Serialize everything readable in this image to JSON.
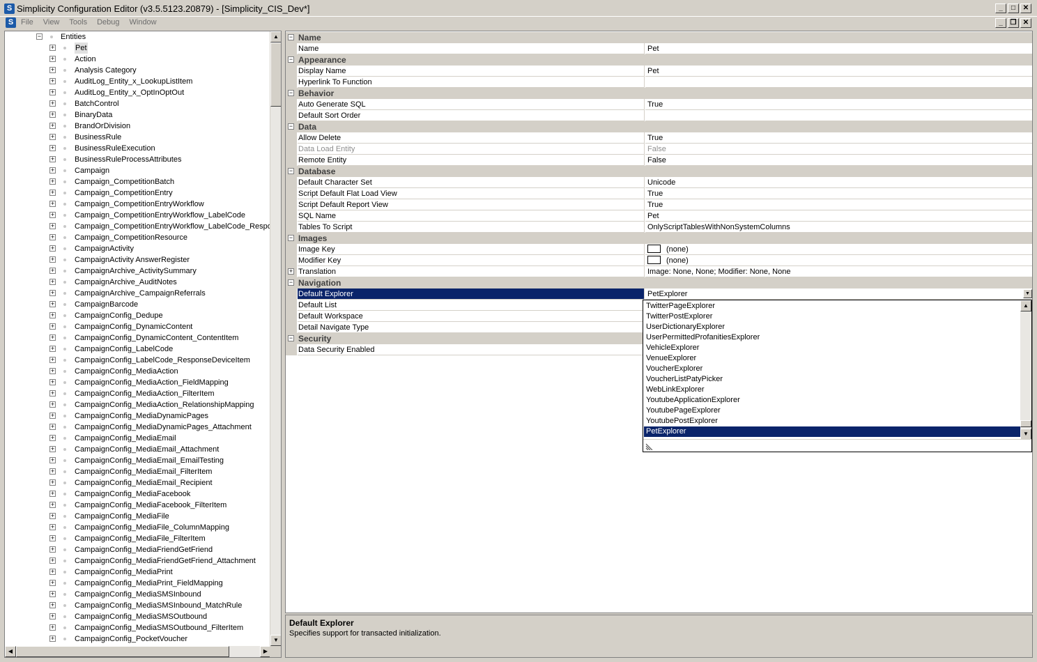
{
  "window": {
    "app_icon": "S",
    "title": "Simplicity Configuration Editor (v3.5.5123.20879) - [Simplicity_CIS_Dev*]",
    "controls": [
      "_",
      "□",
      "✕"
    ]
  },
  "menu": {
    "items": [
      "File",
      "View",
      "Tools",
      "Debug",
      "Window"
    ],
    "mdi_controls": [
      "_",
      "❐",
      "✕"
    ]
  },
  "tree": {
    "root": "Entities",
    "items": [
      "Pet",
      "Action",
      "Analysis Category",
      "AuditLog_Entity_x_LookupListItem",
      "AuditLog_Entity_x_OptInOptOut",
      "BatchControl",
      "BinaryData",
      "BrandOrDivision",
      "BusinessRule",
      "BusinessRuleExecution",
      "BusinessRuleProcessAttributes",
      "Campaign",
      "Campaign_CompetitionBatch",
      "Campaign_CompetitionEntry",
      "Campaign_CompetitionEntryWorkflow",
      "Campaign_CompetitionEntryWorkflow_LabelCode",
      "Campaign_CompetitionEntryWorkflow_LabelCode_Responses",
      "Campaign_CompetitionResource",
      "CampaignActivity",
      "CampaignActivity AnswerRegister",
      "CampaignArchive_ActivitySummary",
      "CampaignArchive_AuditNotes",
      "CampaignArchive_CampaignReferrals",
      "CampaignBarcode",
      "CampaignConfig_Dedupe",
      "CampaignConfig_DynamicContent",
      "CampaignConfig_DynamicContent_ContentItem",
      "CampaignConfig_LabelCode",
      "CampaignConfig_LabelCode_ResponseDeviceItem",
      "CampaignConfig_MediaAction",
      "CampaignConfig_MediaAction_FieldMapping",
      "CampaignConfig_MediaAction_FilterItem",
      "CampaignConfig_MediaAction_RelationshipMapping",
      "CampaignConfig_MediaDynamicPages",
      "CampaignConfig_MediaDynamicPages_Attachment",
      "CampaignConfig_MediaEmail",
      "CampaignConfig_MediaEmail_Attachment",
      "CampaignConfig_MediaEmail_EmailTesting",
      "CampaignConfig_MediaEmail_FilterItem",
      "CampaignConfig_MediaEmail_Recipient",
      "CampaignConfig_MediaFacebook",
      "CampaignConfig_MediaFacebook_FilterItem",
      "CampaignConfig_MediaFile",
      "CampaignConfig_MediaFile_ColumnMapping",
      "CampaignConfig_MediaFile_FilterItem",
      "CampaignConfig_MediaFriendGetFriend",
      "CampaignConfig_MediaFriendGetFriend_Attachment",
      "CampaignConfig_MediaPrint",
      "CampaignConfig_MediaPrint_FieldMapping",
      "CampaignConfig_MediaSMSInbound",
      "CampaignConfig_MediaSMSInbound_MatchRule",
      "CampaignConfig_MediaSMSOutbound",
      "CampaignConfig_MediaSMSOutbound_FilterItem",
      "CampaignConfig_PocketVoucher"
    ],
    "selected_index": 0
  },
  "properties": {
    "rows": [
      {
        "kind": "category",
        "label": "Name"
      },
      {
        "kind": "prop",
        "name": "Name",
        "value": "Pet"
      },
      {
        "kind": "category",
        "label": "Appearance"
      },
      {
        "kind": "prop",
        "name": "Display Name",
        "value": "Pet"
      },
      {
        "kind": "prop",
        "name": "Hyperlink To Function",
        "value": ""
      },
      {
        "kind": "category",
        "label": "Behavior"
      },
      {
        "kind": "prop",
        "name": "Auto Generate SQL",
        "value": "True"
      },
      {
        "kind": "prop",
        "name": "Default Sort Order",
        "value": ""
      },
      {
        "kind": "category",
        "label": "Data"
      },
      {
        "kind": "prop",
        "name": "Allow Delete",
        "value": "True"
      },
      {
        "kind": "prop",
        "name": "Data Load Entity",
        "value": "False",
        "greyed": true
      },
      {
        "kind": "prop",
        "name": "Remote Entity",
        "value": "False"
      },
      {
        "kind": "category",
        "label": "Database"
      },
      {
        "kind": "prop",
        "name": "Default Character Set",
        "value": "Unicode"
      },
      {
        "kind": "prop",
        "name": "Script Default Flat Load View",
        "value": "True"
      },
      {
        "kind": "prop",
        "name": "Script Default Report View",
        "value": "True"
      },
      {
        "kind": "prop",
        "name": "SQL Name",
        "value": "Pet"
      },
      {
        "kind": "prop",
        "name": "Tables To Script",
        "value": "OnlyScriptTablesWithNonSystemColumns"
      },
      {
        "kind": "category",
        "label": "Images"
      },
      {
        "kind": "prop",
        "name": "Image Key",
        "value": "(none)",
        "swatch": true
      },
      {
        "kind": "prop",
        "name": "Modifier Key",
        "value": "(none)",
        "swatch": true
      },
      {
        "kind": "prop",
        "name": "Translation",
        "value": "Image: None, None; Modifier: None, None",
        "expandable": true
      },
      {
        "kind": "category",
        "label": "Navigation"
      },
      {
        "kind": "prop",
        "name": "Default Explorer",
        "value": "PetExplorer",
        "selected": true,
        "dropdown": true
      },
      {
        "kind": "prop",
        "name": "Default List",
        "value": ""
      },
      {
        "kind": "prop",
        "name": "Default Workspace",
        "value": ""
      },
      {
        "kind": "prop",
        "name": "Detail Navigate Type",
        "value": ""
      },
      {
        "kind": "category",
        "label": "Security"
      },
      {
        "kind": "prop",
        "name": "Data Security Enabled",
        "value": ""
      }
    ]
  },
  "dropdown": {
    "options": [
      "TwitterPageExplorer",
      "TwitterPostExplorer",
      "UserDictionaryExplorer",
      "UserPermittedProfanitiesExplorer",
      "VehicleExplorer",
      "VenueExplorer",
      "VoucherExplorer",
      "VoucherListPatyPicker",
      "WebLinkExplorer",
      "YoutubeApplicationExplorer",
      "YoutubePageExplorer",
      "YoutubePostExplorer",
      "PetExplorer"
    ],
    "selected_index": 12
  },
  "description": {
    "title": "Default Explorer",
    "text": "Specifies support for transacted initialization."
  }
}
